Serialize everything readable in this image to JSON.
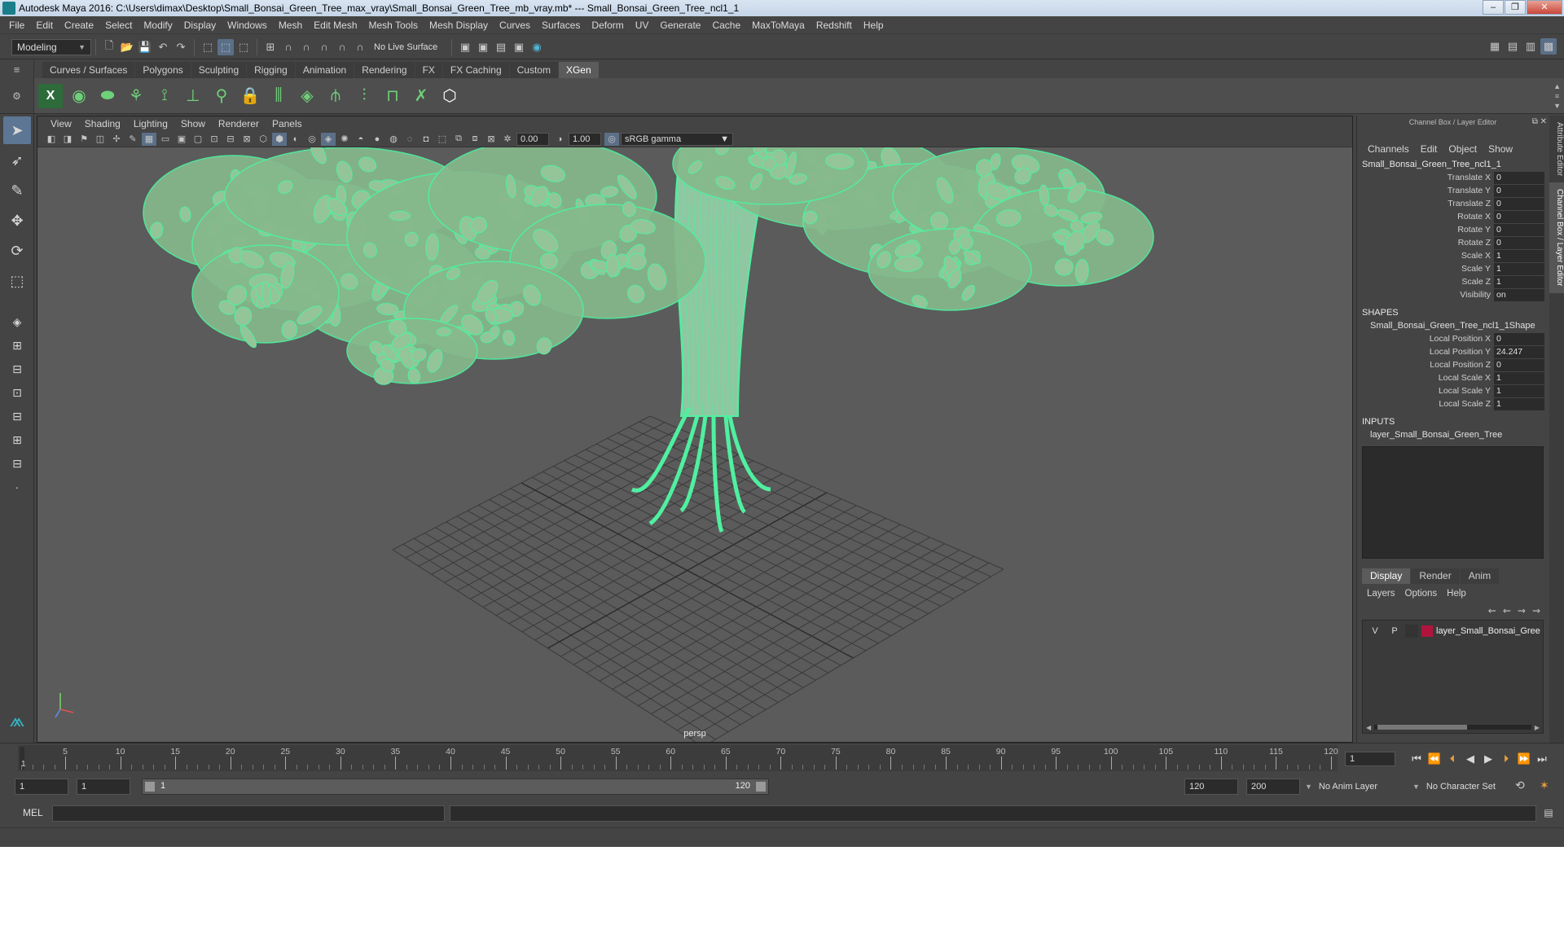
{
  "window": {
    "title": "Autodesk Maya 2016: C:\\Users\\dimax\\Desktop\\Small_Bonsai_Green_Tree_max_vray\\Small_Bonsai_Green_Tree_mb_vray.mb*   ---   Small_Bonsai_Green_Tree_ncl1_1",
    "minimize": "‒",
    "maximize": "❐",
    "close": "✕"
  },
  "menu": [
    "File",
    "Edit",
    "Create",
    "Select",
    "Modify",
    "Display",
    "Windows",
    "Mesh",
    "Edit Mesh",
    "Mesh Tools",
    "Mesh Display",
    "Curves",
    "Surfaces",
    "Deform",
    "UV",
    "Generate",
    "Cache",
    "MaxToMaya",
    "Redshift",
    "Help"
  ],
  "status_line": {
    "mode": "Modeling",
    "live_surface": "No Live Surface"
  },
  "shelf": {
    "tabs": [
      "Curves / Surfaces",
      "Polygons",
      "Sculpting",
      "Rigging",
      "Animation",
      "Rendering",
      "FX",
      "FX Caching",
      "Custom",
      "XGen"
    ],
    "active_tab": "XGen"
  },
  "viewport": {
    "menu": [
      "View",
      "Shading",
      "Lighting",
      "Show",
      "Renderer",
      "Panels"
    ],
    "exposure": "0.00",
    "gamma": "1.00",
    "color_space": "sRGB gamma",
    "camera": "persp",
    "colors": {
      "mesh": "#4ff0a0",
      "background": "#5b5b5b",
      "grid": "#3a3a3a"
    }
  },
  "channel_box": {
    "header": "Channel Box / Layer Editor",
    "menu": [
      "Channels",
      "Edit",
      "Object",
      "Show"
    ],
    "node": "Small_Bonsai_Green_Tree_ncl1_1",
    "channels": [
      {
        "label": "Translate X",
        "value": "0"
      },
      {
        "label": "Translate Y",
        "value": "0"
      },
      {
        "label": "Translate Z",
        "value": "0"
      },
      {
        "label": "Rotate X",
        "value": "0"
      },
      {
        "label": "Rotate Y",
        "value": "0"
      },
      {
        "label": "Rotate Z",
        "value": "0"
      },
      {
        "label": "Scale X",
        "value": "1"
      },
      {
        "label": "Scale Y",
        "value": "1"
      },
      {
        "label": "Scale Z",
        "value": "1"
      },
      {
        "label": "Visibility",
        "value": "on"
      }
    ],
    "shapes_title": "SHAPES",
    "shape_node": "Small_Bonsai_Green_Tree_ncl1_1Shape",
    "shape_channels": [
      {
        "label": "Local Position X",
        "value": "0"
      },
      {
        "label": "Local Position Y",
        "value": "24.247"
      },
      {
        "label": "Local Position Z",
        "value": "0"
      },
      {
        "label": "Local Scale X",
        "value": "1"
      },
      {
        "label": "Local Scale Y",
        "value": "1"
      },
      {
        "label": "Local Scale Z",
        "value": "1"
      }
    ],
    "inputs_title": "INPUTS",
    "input_node": "layer_Small_Bonsai_Green_Tree"
  },
  "layer_editor": {
    "tabs": [
      "Display",
      "Render",
      "Anim"
    ],
    "active_tab": "Display",
    "menu": [
      "Layers",
      "Options",
      "Help"
    ],
    "layer": {
      "v": "V",
      "p": "P",
      "name": "layer_Small_Bonsai_Gree",
      "color": "#b0143c"
    }
  },
  "side_tabs": [
    "Attribute Editor",
    "Channel Box / Layer Editor"
  ],
  "time_slider": {
    "ticks": [
      5,
      10,
      15,
      20,
      25,
      30,
      35,
      40,
      45,
      50,
      55,
      60,
      65,
      70,
      75,
      80,
      85,
      90,
      95,
      100,
      105,
      110,
      115,
      120
    ],
    "current_frame_label": "1",
    "current_frame": "1",
    "min": 1,
    "max": 120
  },
  "range_slider": {
    "start": "1",
    "playback_start": "1",
    "range_start": "1",
    "range_end": "120",
    "playback_end": "120",
    "end": "200",
    "anim_layer": "No Anim Layer",
    "character_set": "No Character Set"
  },
  "command_line": {
    "label": "MEL"
  }
}
